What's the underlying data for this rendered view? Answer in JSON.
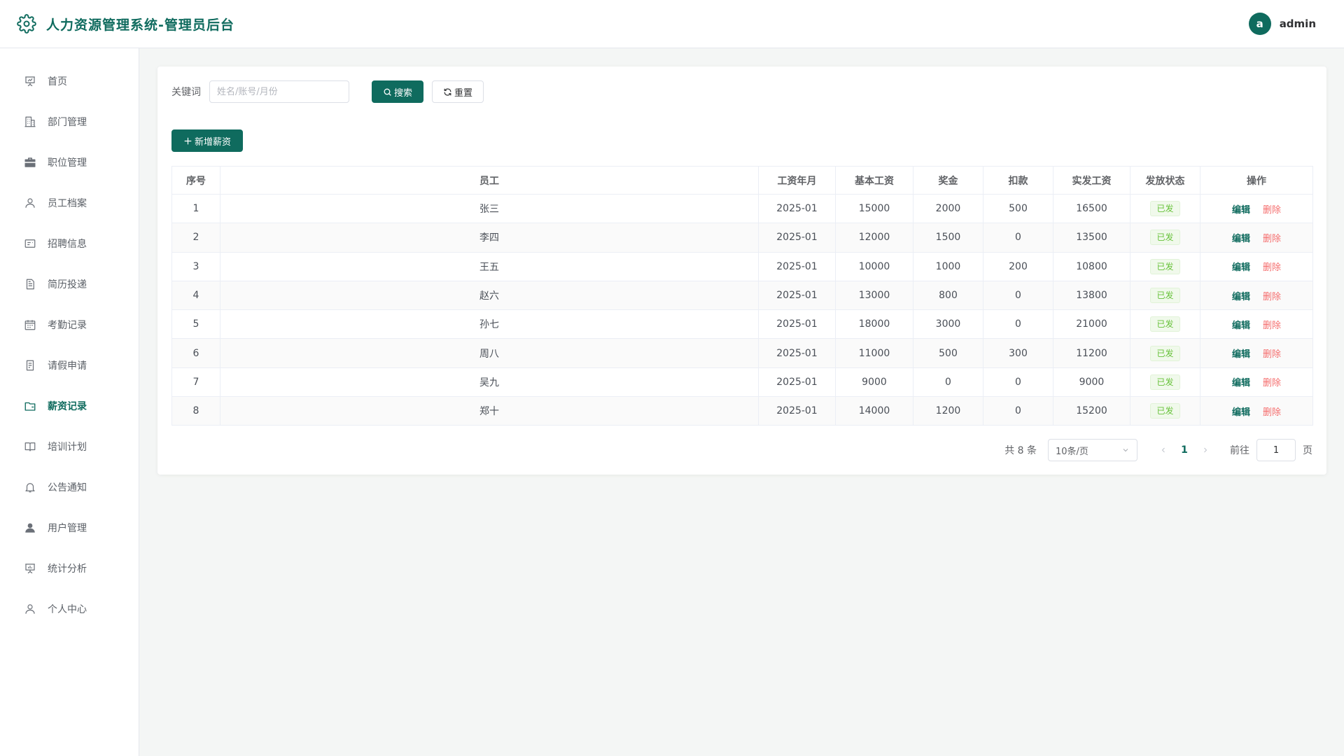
{
  "header": {
    "title": "人力资源管理系统-管理员后台",
    "avatar_letter": "a",
    "username": "admin"
  },
  "colors": {
    "primary": "#0f6b5e",
    "danger": "#f56c6c",
    "success": "#67c23a"
  },
  "sidebar": {
    "items": [
      {
        "label": "首页",
        "icon": "presentation-icon"
      },
      {
        "label": "部门管理",
        "icon": "building-icon"
      },
      {
        "label": "职位管理",
        "icon": "briefcase-icon"
      },
      {
        "label": "员工档案",
        "icon": "user-icon"
      },
      {
        "label": "招聘信息",
        "icon": "id-card-icon"
      },
      {
        "label": "简历投递",
        "icon": "document-icon"
      },
      {
        "label": "考勤记录",
        "icon": "calendar-icon"
      },
      {
        "label": "请假申请",
        "icon": "tickets-icon"
      },
      {
        "label": "薪资记录",
        "icon": "wallet-icon",
        "active": true
      },
      {
        "label": "培训计划",
        "icon": "book-icon"
      },
      {
        "label": "公告通知",
        "icon": "bell-icon"
      },
      {
        "label": "用户管理",
        "icon": "user-filled-icon"
      },
      {
        "label": "统计分析",
        "icon": "data-board-icon"
      },
      {
        "label": "个人中心",
        "icon": "user-icon"
      }
    ]
  },
  "search": {
    "label": "关键词",
    "placeholder": "姓名/账号/月份",
    "search_label": "搜索",
    "reset_label": "重置"
  },
  "toolbar": {
    "add_label": "新增薪资"
  },
  "table": {
    "columns": [
      "序号",
      "员工",
      "工资年月",
      "基本工资",
      "奖金",
      "扣款",
      "实发工资",
      "发放状态",
      "操作"
    ],
    "rows": [
      {
        "index": "1",
        "employee": "张三",
        "month": "2025-01",
        "base": "15000",
        "bonus": "2000",
        "deduction": "500",
        "net": "16500",
        "status": "已发"
      },
      {
        "index": "2",
        "employee": "李四",
        "month": "2025-01",
        "base": "12000",
        "bonus": "1500",
        "deduction": "0",
        "net": "13500",
        "status": "已发"
      },
      {
        "index": "3",
        "employee": "王五",
        "month": "2025-01",
        "base": "10000",
        "bonus": "1000",
        "deduction": "200",
        "net": "10800",
        "status": "已发"
      },
      {
        "index": "4",
        "employee": "赵六",
        "month": "2025-01",
        "base": "13000",
        "bonus": "800",
        "deduction": "0",
        "net": "13800",
        "status": "已发"
      },
      {
        "index": "5",
        "employee": "孙七",
        "month": "2025-01",
        "base": "18000",
        "bonus": "3000",
        "deduction": "0",
        "net": "21000",
        "status": "已发"
      },
      {
        "index": "6",
        "employee": "周八",
        "month": "2025-01",
        "base": "11000",
        "bonus": "500",
        "deduction": "300",
        "net": "11200",
        "status": "已发"
      },
      {
        "index": "7",
        "employee": "吴九",
        "month": "2025-01",
        "base": "9000",
        "bonus": "0",
        "deduction": "0",
        "net": "9000",
        "status": "已发"
      },
      {
        "index": "8",
        "employee": "郑十",
        "month": "2025-01",
        "base": "14000",
        "bonus": "1200",
        "deduction": "0",
        "net": "15200",
        "status": "已发"
      }
    ],
    "edit_label": "编辑",
    "delete_label": "删除"
  },
  "pagination": {
    "total_text": "共 8 条",
    "page_size": "10条/页",
    "current_page": "1",
    "goto_label": "前往",
    "goto_value": "1",
    "page_unit": "页"
  }
}
